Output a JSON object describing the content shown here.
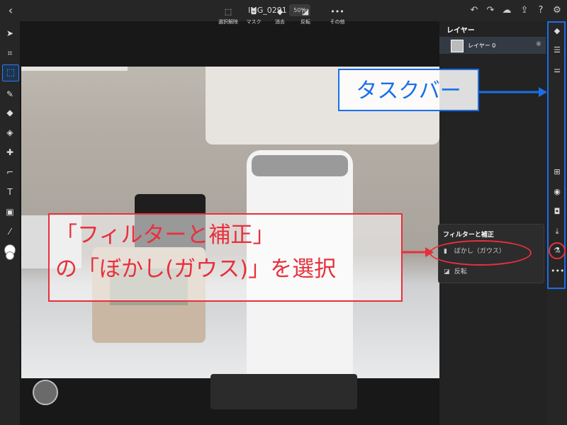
{
  "topbar": {
    "doc_title": "IMG_0291",
    "zoom": "50%",
    "icons": [
      "back-icon",
      "undo-icon",
      "redo-icon",
      "cloud-icon",
      "share-icon",
      "help-icon",
      "gear-icon"
    ]
  },
  "left_toolbar": {
    "tools": [
      "move-icon",
      "transform-icon",
      "selection-icon",
      "brush-icon",
      "eraser-icon",
      "fill-icon",
      "healing-icon",
      "crop-icon",
      "text-icon",
      "image-icon",
      "eyedropper-icon",
      "color-icon"
    ],
    "subtools": [
      "selection-add-icon",
      "selection-subtract-icon",
      "selection-intersect-icon",
      "more-icon"
    ]
  },
  "bottom_toolbar": {
    "items": [
      {
        "label": "選択解除",
        "icon": "deselect-icon"
      },
      {
        "label": "マスク",
        "icon": "mask-icon"
      },
      {
        "label": "消去",
        "icon": "erase-icon"
      },
      {
        "label": "反転",
        "icon": "invert-icon"
      },
      {
        "label": "その他",
        "icon": "more-icon"
      }
    ]
  },
  "layers_panel": {
    "title": "レイヤー",
    "layers": [
      {
        "name": "レイヤー 0"
      }
    ]
  },
  "filter_menu": {
    "title": "フィルターと補正",
    "items": [
      {
        "label": "ぼかし（ガウス）",
        "icon": "blur-icon"
      },
      {
        "label": "反転",
        "icon": "invert-icon"
      }
    ]
  },
  "annotations": {
    "taskbar_label": "タスクバー",
    "instruction_line1": "「フィルターと補正」",
    "instruction_line2": "の「ぼかし(ガウス)」を選択",
    "colors": {
      "blue": "#1a6fe8",
      "red": "#e8303c"
    }
  }
}
